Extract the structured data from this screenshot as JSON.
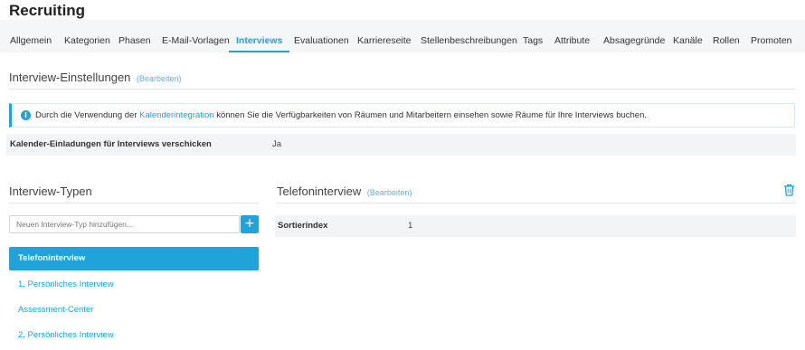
{
  "app": {
    "title": "Recruiting"
  },
  "tabs": [
    {
      "label": "Allgemein",
      "active": false
    },
    {
      "label": "Kategorien",
      "active": false
    },
    {
      "label": "Phasen",
      "active": false
    },
    {
      "label": "E-Mail-Vorlagen",
      "active": false
    },
    {
      "label": "Interviews",
      "active": true
    },
    {
      "label": "Evaluationen",
      "active": false
    },
    {
      "label": "Karriereseite",
      "active": false
    },
    {
      "label": "Stellenbeschreibungen",
      "active": false
    },
    {
      "label": "Tags",
      "active": false
    },
    {
      "label": "Attribute",
      "active": false
    },
    {
      "label": "Absagegründe",
      "active": false
    },
    {
      "label": "Kanäle",
      "active": false
    },
    {
      "label": "Rollen",
      "active": false
    },
    {
      "label": "Promoten",
      "active": false
    }
  ],
  "settings": {
    "title": "Interview-Einstellungen",
    "edit_label": "(Bearbeiten)",
    "info": {
      "text_before": "Durch die Verwendung der",
      "link": "Kalenderintegration",
      "text_after": "können Sie die Verfügbarkeiten von Räumen und Mitarbeitern einsehen sowie Räume für Ihre Interviews buchen."
    },
    "calendar_invites_label": "Kalender-Einladungen für Interviews verschicken",
    "calendar_invites_value": "Ja"
  },
  "types": {
    "title": "Interview-Typen",
    "add_placeholder": "Neuen Interview-Typ hinzufügen...",
    "add_button": "+",
    "items": [
      {
        "label": "Telefoninterview",
        "active": true
      },
      {
        "label": "1. Persönliches Interview",
        "active": false
      },
      {
        "label": "Assessment-Center",
        "active": false
      },
      {
        "label": "2. Persönliches Interview",
        "active": false
      }
    ]
  },
  "detail": {
    "title": "Telefoninterview",
    "edit_label": "(Bearbeiten)",
    "sort_label": "Sortierindex",
    "sort_value": "1"
  },
  "colors": {
    "accent": "#1fa3d8",
    "tabbar_bg": "#f5f6f8",
    "row_bg": "#f3f4f6"
  },
  "icons": {
    "info": "info-icon",
    "delete": "trash-icon",
    "add": "plus-icon"
  }
}
